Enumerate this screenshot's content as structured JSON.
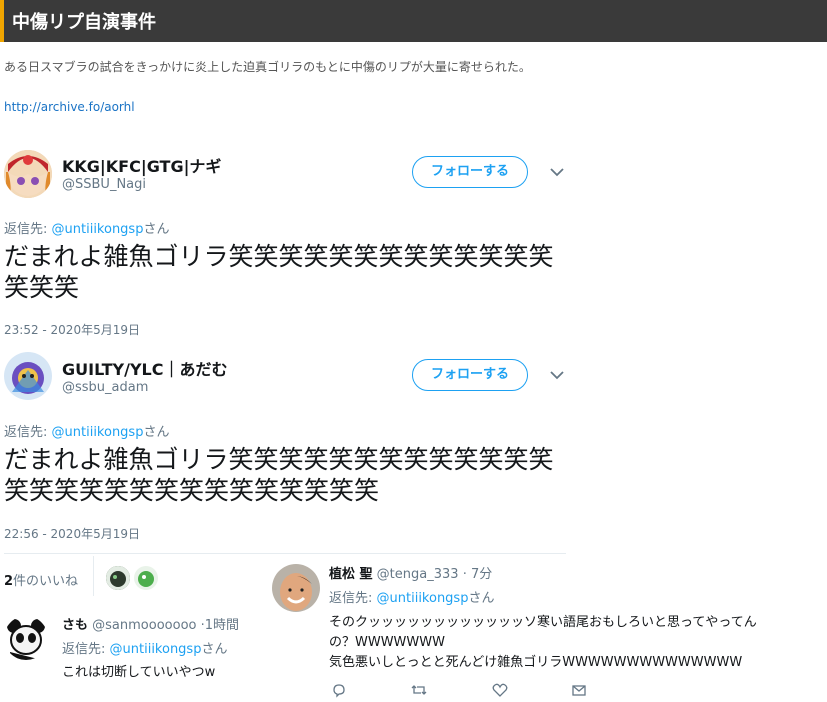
{
  "header": {
    "title": "中傷リプ自演事件",
    "accent": "#f0a500"
  },
  "intro": "ある日スマブラの試合をきっかけに炎上した迫真ゴリラのもとに中傷のリプが大量に寄せられた。",
  "link": "http://archive.fo/aorhl",
  "tweets": [
    {
      "display_name": "KKG|KFC|GTG|ナギ",
      "handle": "@SSBU_Nagi",
      "follow_label": "フォローする",
      "reply_prefix": "返信先: ",
      "reply_to": "@untiiikongsp",
      "reply_suffix": "さん",
      "body": "だまれよ雑魚ゴリラ笑笑笑笑笑笑笑笑笑笑笑笑笑笑笑笑",
      "time": "23:52 - 2020年5月19日"
    },
    {
      "display_name": "GUILTY/YLC｜あだむ",
      "handle": "@ssbu_adam",
      "follow_label": "フォローする",
      "reply_prefix": "返信先: ",
      "reply_to": "@untiiikongsp",
      "reply_suffix": "さん",
      "body": "だまれよ雑魚ゴリラ笑笑笑笑笑笑笑笑笑笑笑笑笑笑笑笑笑笑笑笑笑笑笑笑笑笑笑笑",
      "time": "22:56 - 2020年5月19日"
    }
  ],
  "likes": {
    "count": "2",
    "label": "件のいいね"
  },
  "reply_sato": {
    "name": "さも",
    "handle": "@sanmooooooo",
    "dot": "·",
    "ago": "1時間",
    "reply_prefix": "返信先: ",
    "reply_to": "@untiiikongsp",
    "reply_suffix": "さん",
    "text": "これは切断していいやつw"
  },
  "reply_tenga": {
    "name": "植松 聖",
    "handle": "@tenga_333",
    "dot": "·",
    "ago": "7分",
    "reply_prefix": "返信先: ",
    "reply_to": "@untiiikongsp",
    "reply_suffix": "さん",
    "line1": "そのクッッッッッッッッッッッッソ寒い語尾おもしろいと思ってやってん",
    "line2": "の？WWWWWWW",
    "line3": "気色悪いしとっとと死んどけ雑魚ゴリラWWWWWWWWWWWWWW"
  },
  "colors": {
    "twitter_blue": "#1da1f2",
    "muted": "#657786"
  }
}
